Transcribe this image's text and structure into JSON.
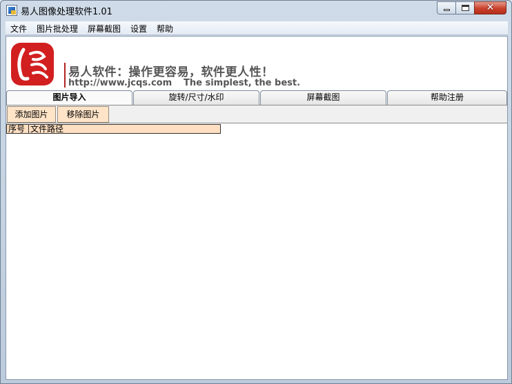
{
  "window": {
    "title": "易人图像处理软件1.01",
    "close_glyph": "✕"
  },
  "menu": [
    "文件",
    "图片批处理",
    "屏幕截图",
    "设置",
    "帮助"
  ],
  "banner": {
    "slogan": "易人软件：操作更容易，软件更人性！",
    "url": "http://www.jcqs.com",
    "tagline": "The simplest, the best.",
    "brand_color": "#d21f1f"
  },
  "tabs": [
    {
      "label": "图片导入",
      "active": true
    },
    {
      "label": "旋转/尺寸/水印",
      "active": false
    },
    {
      "label": "屏幕截图",
      "active": false
    },
    {
      "label": "帮助注册",
      "active": false
    }
  ],
  "toolbar": {
    "add_label": "添加图片",
    "remove_label": "移除图片"
  },
  "table": {
    "columns": [
      "序号",
      "文件路径"
    ],
    "rows": []
  }
}
